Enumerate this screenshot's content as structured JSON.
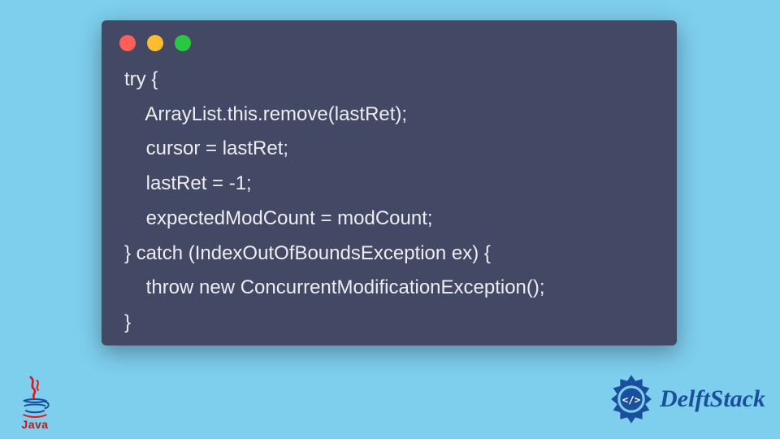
{
  "code": {
    "lines": [
      "try {",
      "    ArrayList.this.remove(lastRet);",
      "    cursor = lastRet;",
      "    lastRet = -1;",
      "    expectedModCount = modCount;",
      "} catch (IndexOutOfBoundsException ex) {",
      "    throw new ConcurrentModificationException();",
      "}"
    ]
  },
  "window": {
    "traffic_lights": [
      "red",
      "yellow",
      "green"
    ]
  },
  "branding": {
    "java_label": "Java",
    "delft_label": "DelftStack"
  },
  "colors": {
    "page_bg": "#7ECEEE",
    "window_bg": "#434864",
    "code_fg": "#EDEEF3",
    "java_red": "#B71C1C",
    "delft_blue": "#1A4F9C"
  }
}
